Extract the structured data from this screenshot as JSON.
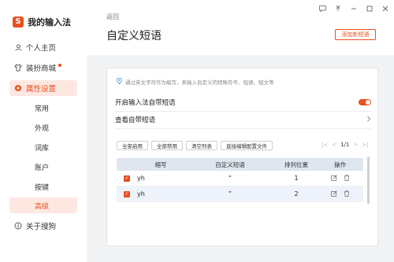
{
  "brand": {
    "logo_char": "S",
    "name": "我的输入法"
  },
  "nav": {
    "items": [
      {
        "label": "个人主页",
        "icon": "user-icon"
      },
      {
        "label": "装扮商城",
        "icon": "shirt-icon",
        "dot": true
      },
      {
        "label": "属性设置",
        "icon": "gear-icon",
        "active": true
      },
      {
        "label": "关于搜狗",
        "icon": "info-icon"
      }
    ],
    "sub_items": [
      "常用",
      "外观",
      "词库",
      "账户",
      "按键",
      "高级"
    ],
    "active_sub": "高级"
  },
  "window": {
    "controls": [
      "feedback-icon",
      "pin-icon",
      "minimize-icon",
      "maximize-icon",
      "close-icon"
    ]
  },
  "header": {
    "back": "返回",
    "title": "自定义短语",
    "add_button": "添加新短语"
  },
  "card": {
    "hint": "通过英文字符作为缩写，来输入自定义的特殊符号、短语、短文等",
    "setting_enable": "开启输入法自带短语",
    "setting_view": "查看自带短语"
  },
  "toolbar": {
    "enable_all": "全部启用",
    "disable_all": "全部禁用",
    "clear_list": "清空列表",
    "edit_file": "直接编辑配置文件"
  },
  "pager": {
    "first": "|<",
    "prev": "<",
    "page": "1/1",
    "next": ">",
    "last": ">|"
  },
  "table": {
    "headers": [
      "缩写",
      "自定义短语",
      "排列位置",
      "操作"
    ],
    "rows": [
      {
        "abbr": "yh",
        "phrase": "“",
        "position": "1"
      },
      {
        "abbr": "yh",
        "phrase": "”",
        "position": "2"
      }
    ]
  },
  "colors": {
    "accent": "#e8501e",
    "active_bg": "#fde8e1",
    "header_bg": "#dfe6f0",
    "row_alt": "#eef3fb",
    "panel_bg": "#f2f3f5"
  }
}
